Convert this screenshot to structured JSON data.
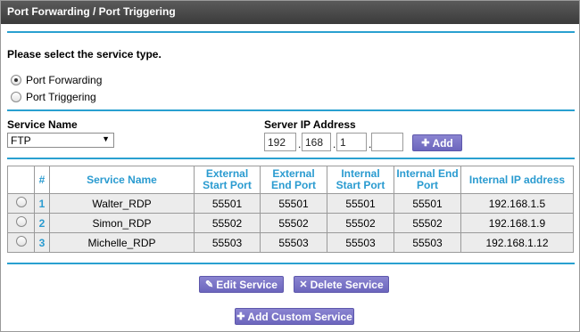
{
  "window": {
    "title": "Port Forwarding / Port Triggering"
  },
  "service_type": {
    "heading": "Please select the service type.",
    "options": [
      {
        "label": "Port Forwarding",
        "checked": true
      },
      {
        "label": "Port Triggering",
        "checked": false
      }
    ]
  },
  "service_name": {
    "label": "Service Name",
    "selected": "FTP"
  },
  "server_ip": {
    "label": "Server IP Address",
    "octets": [
      "192",
      "168",
      "1",
      ""
    ],
    "add_label": "Add"
  },
  "table": {
    "headers": [
      "#",
      "Service Name",
      "External Start Port",
      "External End Port",
      "Internal Start Port",
      "Internal End Port",
      "Internal IP address"
    ],
    "rows": [
      {
        "num": "1",
        "name": "Walter_RDP",
        "ext_start": "55501",
        "ext_end": "55501",
        "int_start": "55501",
        "int_end": "55501",
        "ip": "192.168.1.5"
      },
      {
        "num": "2",
        "name": "Simon_RDP",
        "ext_start": "55502",
        "ext_end": "55502",
        "int_start": "55502",
        "int_end": "55502",
        "ip": "192.168.1.9"
      },
      {
        "num": "3",
        "name": "Michelle_RDP",
        "ext_start": "55503",
        "ext_end": "55503",
        "int_start": "55503",
        "int_end": "55503",
        "ip": "192.168.1.12"
      }
    ]
  },
  "actions": {
    "edit_label": "Edit Service",
    "delete_label": "Delete Service",
    "add_custom_label": "Add Custom Service"
  },
  "colors": {
    "accent": "#29a0d0",
    "button": "#7670c6",
    "titlebar": "#454545"
  }
}
